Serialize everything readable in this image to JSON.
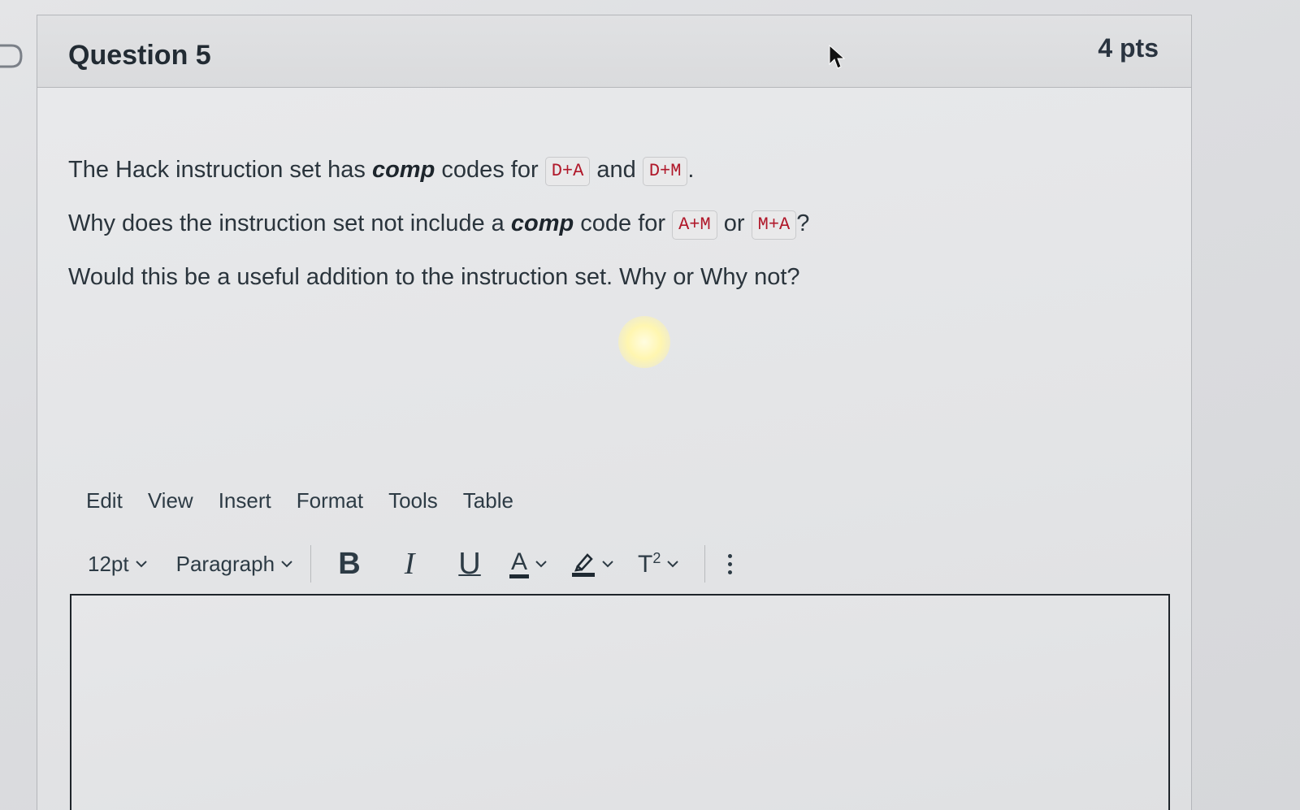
{
  "question": {
    "title": "Question 5",
    "points": "4 pts",
    "line1": {
      "prefix": "The Hack instruction set has ",
      "emphasis": "comp",
      "middle": " codes for ",
      "code1": "D+A",
      "joiner": " and ",
      "code2": "D+M",
      "suffix": "."
    },
    "line2": {
      "prefix": "Why does the instruction set not include a ",
      "emphasis": "comp",
      "middle": " code for ",
      "code1": "A+M",
      "joiner": " or ",
      "code2": "M+A",
      "suffix": "?"
    },
    "line3": "Would this be a useful addition to the instruction set. Why or Why not?"
  },
  "editor": {
    "menu": [
      "Edit",
      "View",
      "Insert",
      "Format",
      "Tools",
      "Table"
    ],
    "font_size": "12pt",
    "block_format": "Paragraph",
    "bold_label": "B",
    "italic_label": "I",
    "underline_label": "U",
    "font_color_label": "A",
    "superscript_label": "T",
    "superscript_exp": "2",
    "body": ""
  },
  "icons": {
    "flag": "flag-icon",
    "cursor": "mouse-pointer-icon",
    "chevron": "chevron-down-icon",
    "highlighter": "highlighter-icon",
    "more": "more-vertical-icon"
  },
  "colors": {
    "code_text": "#b0182a",
    "text": "#2d3b45"
  }
}
